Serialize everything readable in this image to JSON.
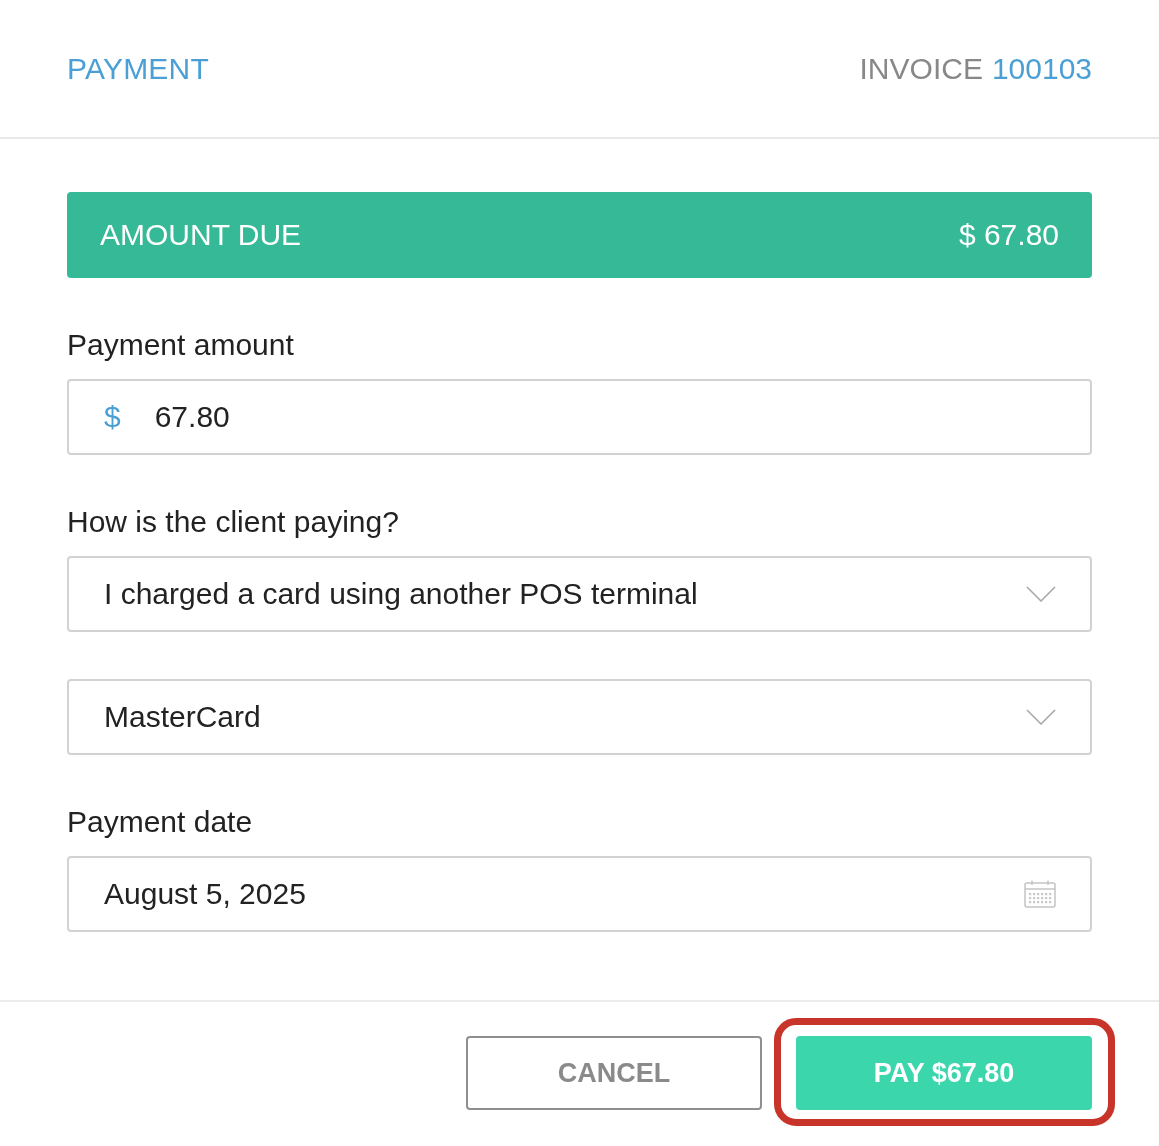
{
  "header": {
    "title": "PAYMENT",
    "invoice_label": "INVOICE",
    "invoice_number": "100103"
  },
  "amount_due": {
    "label": "AMOUNT DUE",
    "value": "$ 67.80"
  },
  "fields": [
    {
      "kind": "currency",
      "label": "Payment amount",
      "prefix": "$",
      "value": "67.80"
    },
    {
      "kind": "select",
      "label": "How is the client paying?",
      "value": "I charged a card using another POS terminal"
    },
    {
      "kind": "select",
      "value": "MasterCard"
    },
    {
      "kind": "date",
      "label": "Payment date",
      "value": "August 5, 2025"
    }
  ],
  "buttons": [
    {
      "kind": "secondary",
      "label": "CANCEL",
      "highlighted": false
    },
    {
      "kind": "primary",
      "label": "PAY $67.80",
      "highlighted": true
    }
  ]
}
